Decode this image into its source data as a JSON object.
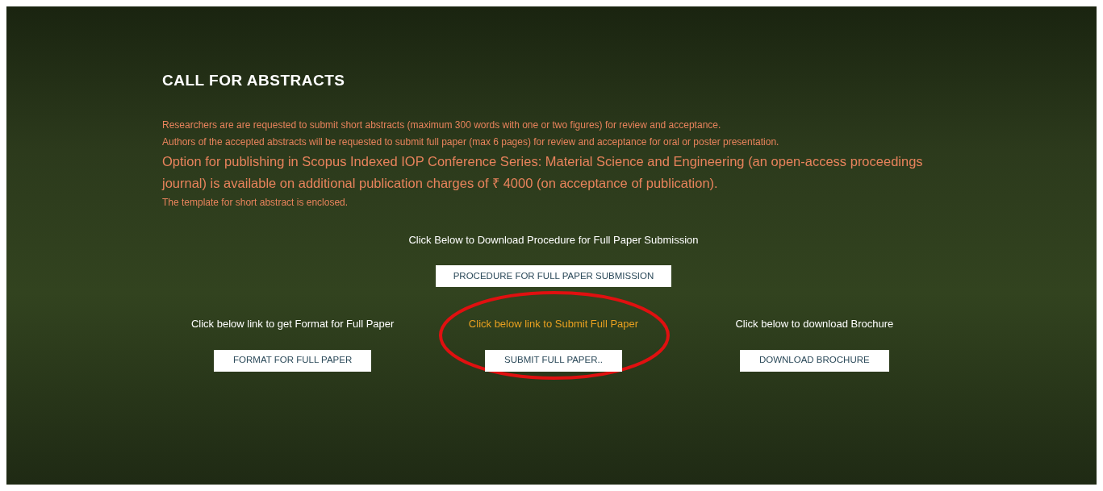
{
  "section": {
    "title": "CALL FOR ABSTRACTS",
    "paragraphs": [
      {
        "text": "Researchers are are requested to submit short abstracts (maximum 300 words with one or two figures) for review and acceptance.",
        "kind": "note"
      },
      {
        "text": "Authors of the accepted abstracts will be requested to submit full paper (max 6 pages) for review and acceptance for oral or poster presentation.",
        "kind": "note"
      },
      {
        "text": "Option for publishing in Scopus Indexed IOP Conference Series: Material Science and Engineering (an open-access proceedings journal) is available on additional publication charges of ₹ 4000 (on acceptance of publication).",
        "kind": "lead"
      },
      {
        "text": "The template for short abstract is enclosed.",
        "kind": "note"
      }
    ],
    "procedure": {
      "label": "Click Below to Download Procedure for Full Paper Submission",
      "button": "PROCEDURE FOR FULL PAPER SUBMISSION"
    },
    "columns": [
      {
        "label": "Click below link to get Format for Full Paper",
        "button": "FORMAT FOR FULL PAPER",
        "highlighted": false,
        "circled": false
      },
      {
        "label": "Click below link to Submit Full Paper",
        "button": "SUBMIT FULL PAPER..",
        "highlighted": true,
        "circled": true
      },
      {
        "label": "Click below to download Brochure",
        "button": "DOWNLOAD BROCHURE",
        "highlighted": false,
        "circled": false
      }
    ]
  }
}
